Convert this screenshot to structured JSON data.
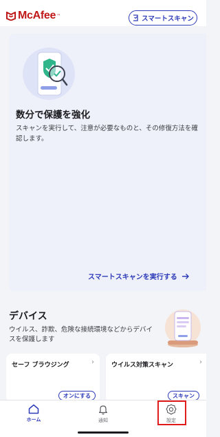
{
  "header": {
    "logo_text": "McAfee",
    "logo_tm": "™",
    "smart_scan_label": "スマートスキャン",
    "brand_color": "#c01818",
    "accent_color": "#2d3bb8"
  },
  "main_card": {
    "title": "数分で保護を強化",
    "description": "スキャンを実行して、注意が必要なものと、その修復方法を確認します。",
    "link_label": "スマートスキャンを実行する"
  },
  "devices": {
    "title": "デバイス",
    "description": "ウイルス、詐欺、危険な接続環境などからデバイスを保護します"
  },
  "tiles": [
    {
      "title": "セーフ ブラウジング",
      "chevron": "›",
      "action_label": "オンにする"
    },
    {
      "title": "ウイルス対策スキャン",
      "chevron": "›",
      "action_label": "スキャン"
    }
  ],
  "nav": {
    "home": {
      "label": "ホーム",
      "icon": "home-icon"
    },
    "notifications": {
      "label": "通知",
      "icon": "bell-icon"
    },
    "settings": {
      "label": "設定",
      "icon": "gear-icon"
    }
  },
  "highlight_color": "#e11b1b"
}
